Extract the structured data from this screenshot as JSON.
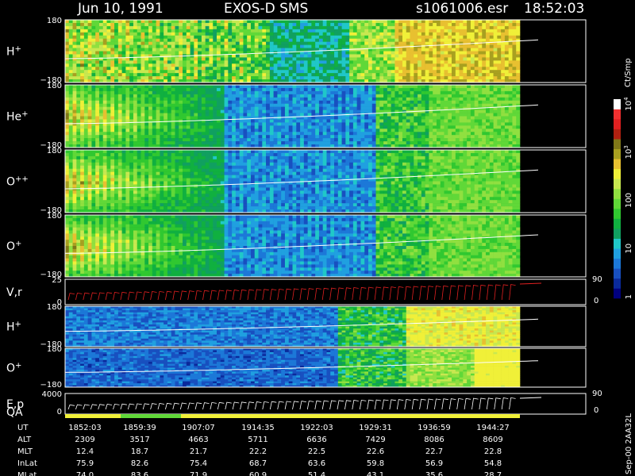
{
  "header": {
    "date": "Jun 10, 1991",
    "instrument": "EXOS-D SMS",
    "file": "s1061006.esr",
    "time": "18:52:03"
  },
  "colorbar": {
    "unit": "Ct/Smp",
    "ticks": [
      {
        "label": "1",
        "value": 1
      },
      {
        "label": "10",
        "value": 10
      },
      {
        "label": "100",
        "value": 100
      },
      {
        "label": "10",
        "sup": "3",
        "value": 1000
      },
      {
        "label": "10",
        "sup": "4",
        "value": 10000
      }
    ],
    "colors": [
      "#000080",
      "#0a2a9c",
      "#1850c0",
      "#1c78d8",
      "#20a0e0",
      "#20c8c8",
      "#10a060",
      "#10b040",
      "#30c830",
      "#60d838",
      "#90e040",
      "#c8e850",
      "#f0f038",
      "#e8c030",
      "#a8a020",
      "#807818",
      "#b02010",
      "#e02020",
      "#f03030",
      "#ffffff"
    ]
  },
  "panels": [
    {
      "name": "h-plus",
      "label": "H",
      "sup": "+",
      "ymax": "180",
      "ymin": "−180",
      "range": [
        -180,
        180
      ]
    },
    {
      "name": "he-plus",
      "label": "He",
      "sup": "+",
      "ymax": "180",
      "ymin": "−180",
      "range": [
        -180,
        180
      ]
    },
    {
      "name": "o-plus-plus",
      "label": "O",
      "sup": "++",
      "ymax": "180",
      "ymin": "−180",
      "range": [
        -180,
        180
      ]
    },
    {
      "name": "o-plus",
      "label": "O",
      "sup": "+",
      "ymax": "180",
      "ymin": "−180",
      "range": [
        -180,
        180
      ]
    },
    {
      "name": "vr",
      "label": "V,r",
      "sup": "",
      "ymax": "25",
      "ymin": "0",
      "rmax": "90",
      "rmin": "0",
      "range": [
        0,
        25
      ]
    },
    {
      "name": "h-plus-2",
      "label": "H",
      "sup": "+",
      "ymax": "180",
      "ymin": "−180",
      "range": [
        -180,
        180
      ]
    },
    {
      "name": "o-plus-2",
      "label": "O",
      "sup": "+",
      "ymax": "180",
      "ymin": "−180",
      "range": [
        -180,
        180
      ]
    },
    {
      "name": "ep-qa",
      "label": "E,p",
      "label2": "QA",
      "sup": "",
      "ymax": "4000",
      "ymin": "0",
      "rmax": "90",
      "rmin": "0",
      "range": [
        0,
        4000
      ]
    }
  ],
  "ephemeris": {
    "rows": [
      {
        "label": "UT",
        "values": [
          "1852:03",
          "1859:39",
          "1907:07",
          "1914:35",
          "1922:03",
          "1929:31",
          "1936:59",
          "1944:27"
        ]
      },
      {
        "label": "ALT",
        "values": [
          "2309",
          "3517",
          "4663",
          "5711",
          "6636",
          "7429",
          "8086",
          "8609"
        ]
      },
      {
        "label": "MLT",
        "values": [
          "12.4",
          "18.7",
          "21.7",
          "22.2",
          "22.5",
          "22.6",
          "22.7",
          "22.8"
        ]
      },
      {
        "label": "InLat",
        "values": [
          "75.9",
          "82.6",
          "75.4",
          "68.7",
          "63.6",
          "59.8",
          "56.9",
          "54.8"
        ]
      },
      {
        "label": "MLat",
        "values": [
          "74.0",
          "83.6",
          "71.9",
          "60.9",
          "51.4",
          "43.1",
          "35.6",
          "28.7"
        ]
      }
    ]
  },
  "side_label": "Sep-00 2AA32L",
  "chart_data": {
    "type": "heatmap",
    "title": "Jun 10, 1991   EXOS-D SMS",
    "x_ticks": [
      "1852:03",
      "1859:39",
      "1907:07",
      "1914:35",
      "1922:03",
      "1929:31",
      "1936:59",
      "1944:27"
    ],
    "colorbar_unit": "Ct/Smp",
    "colorbar_range": [
      1,
      10000
    ],
    "colorbar_scale": "log",
    "series": [
      "H+",
      "He+",
      "O++",
      "O+",
      "V,r",
      "H+",
      "O+",
      "E,p QA"
    ]
  }
}
